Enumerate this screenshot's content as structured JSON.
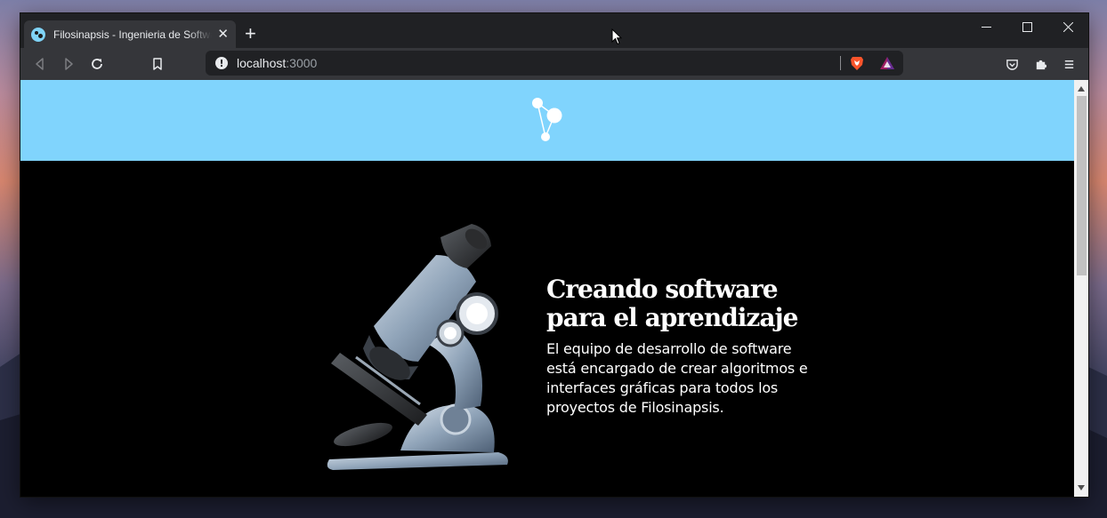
{
  "browser": {
    "tab": {
      "title": "Filosinapsis - Ingenieria de Software",
      "close_glyph": "✕"
    },
    "new_tab_glyph": "+",
    "window_controls": [
      "minimize",
      "maximize",
      "close"
    ],
    "address": {
      "host": "localhost",
      "port": ":3000"
    },
    "icons": {
      "info": "!",
      "brave": "brave-shield-icon",
      "rewards": "brave-rewards-icon",
      "pocket": "pocket-icon",
      "extensions": "puzzle-icon",
      "menu": "hamburger-menu-icon"
    }
  },
  "site": {
    "header_color": "#80d4fd",
    "logo": "filosinapsis-logo",
    "hero": {
      "image": "microscope",
      "title_line1": "Creando software",
      "title_line2": "para el aprendizaje",
      "description": "El equipo de desarrollo de software está encargado de crear algoritmos e interfaces gráficas para todos los proyectos de Filosinapsis."
    }
  }
}
